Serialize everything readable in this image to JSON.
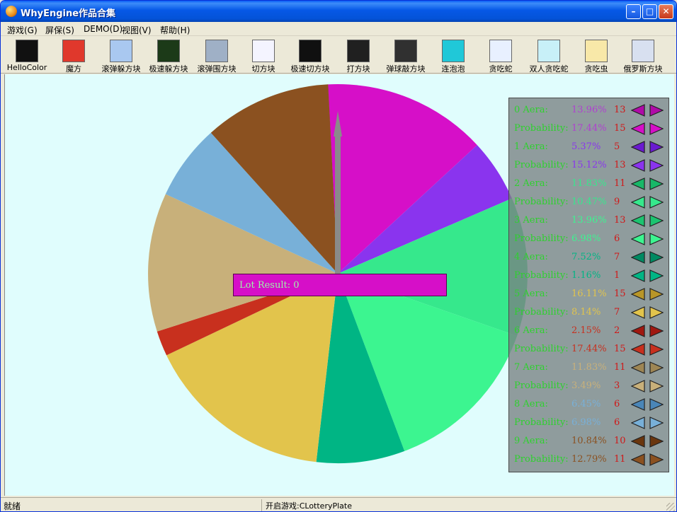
{
  "window": {
    "title": "WhyEngine作品合集",
    "minimize": "–",
    "maximize": "□",
    "close": "✕"
  },
  "menu": [
    "游戏(G)",
    "屏保(S)",
    "DEMO(D)",
    "视图(V)",
    "帮助(H)"
  ],
  "toolbar": [
    {
      "label": "HelloColor",
      "icon": "hello-color-icon",
      "color": "#111111"
    },
    {
      "label": "魔方",
      "icon": "rubik-cube-icon",
      "color": "#e0382c"
    },
    {
      "label": "滚弹躲方块",
      "icon": "ball-dodge-icon",
      "color": "#a9c8f0"
    },
    {
      "label": "极速躲方块",
      "icon": "speed-dodge-icon",
      "color": "#1c3a18"
    },
    {
      "label": "滚弹围方块",
      "icon": "ball-circle-icon",
      "color": "#9fb0c6"
    },
    {
      "label": "切方块",
      "icon": "cut-block-icon",
      "color": "#f4f4ff"
    },
    {
      "label": "极速切方块",
      "icon": "speed-cut-icon",
      "color": "#101010"
    },
    {
      "label": "打方块",
      "icon": "hit-block-icon",
      "color": "#202020"
    },
    {
      "label": "弹球敲方块",
      "icon": "pinball-block-icon",
      "color": "#303030"
    },
    {
      "label": "连泡泡",
      "icon": "bubble-link-icon",
      "color": "#20c8d8"
    },
    {
      "label": "贪吃蛇",
      "icon": "snake-icon",
      "color": "#e8f0ff"
    },
    {
      "label": "双人贪吃蛇",
      "icon": "two-player-snake-icon",
      "color": "#c8f0f8"
    },
    {
      "label": "贪吃虫",
      "icon": "worm-icon",
      "color": "#f8e8a8"
    },
    {
      "label": "俄罗斯方块",
      "icon": "tetris-icon",
      "color": "#d8e0f0"
    }
  ],
  "lot_result": "Lot Result: 0",
  "sectors": [
    {
      "index": 0,
      "aera_label": "0 Aera:",
      "aera": "13.96%",
      "aera_count": "13",
      "prob_label": "Probability:",
      "prob": "17.44%",
      "prob_count": "15",
      "color": "#d60fc8",
      "text_color": "#b040d0",
      "dark": "#b00aa8"
    },
    {
      "index": 1,
      "aera_label": "1 Aera:",
      "aera": "5.37%",
      "aera_count": "5",
      "prob_label": "Probability:",
      "prob": "15.12%",
      "prob_count": "13",
      "color": "#8a34ee",
      "text_color": "#8a34ee",
      "dark": "#6a1ad0"
    },
    {
      "index": 2,
      "aera_label": "2 Aera:",
      "aera": "11.83%",
      "aera_count": "11",
      "prob_label": "Probability:",
      "prob": "10.47%",
      "prob_count": "9",
      "color": "#36e88c",
      "text_color": "#36e88c",
      "dark": "#18b868"
    },
    {
      "index": 3,
      "aera_label": "3 Aera:",
      "aera": "13.96%",
      "aera_count": "13",
      "prob_label": "Probability:",
      "prob": "6.98%",
      "prob_count": "6",
      "color": "#3cf590",
      "text_color": "#3cf590",
      "dark": "#1cc470"
    },
    {
      "index": 4,
      "aera_label": "4 Aera:",
      "aera": "7.52%",
      "aera_count": "7",
      "prob_label": "Probability:",
      "prob": "1.16%",
      "prob_count": "1",
      "color": "#00b584",
      "text_color": "#00b584",
      "dark": "#008a62"
    },
    {
      "index": 5,
      "aera_label": "5 Aera:",
      "aera": "16.11%",
      "aera_count": "15",
      "prob_label": "Probability:",
      "prob": "8.14%",
      "prob_count": "7",
      "color": "#e2c44c",
      "text_color": "#e2c44c",
      "dark": "#b89628"
    },
    {
      "index": 6,
      "aera_label": "6 Aera:",
      "aera": "2.15%",
      "aera_count": "2",
      "prob_label": "Probability:",
      "prob": "17.44%",
      "prob_count": "15",
      "color": "#c8301e",
      "text_color": "#c8301e",
      "dark": "#a01810"
    },
    {
      "index": 7,
      "aera_label": "7 Aera:",
      "aera": "11.83%",
      "aera_count": "11",
      "prob_label": "Probability:",
      "prob": "3.49%",
      "prob_count": "3",
      "color": "#c8b07a",
      "text_color": "#c8b07a",
      "dark": "#9e8654"
    },
    {
      "index": 8,
      "aera_label": "8 Aera:",
      "aera": "6.45%",
      "aera_count": "6",
      "prob_label": "Probability:",
      "prob": "6.98%",
      "prob_count": "6",
      "color": "#78b0d8",
      "text_color": "#78b0d8",
      "dark": "#4a86b8"
    },
    {
      "index": 9,
      "aera_label": "9 Aera:",
      "aera": "10.84%",
      "aera_count": "10",
      "prob_label": "Probability:",
      "prob": "12.79%",
      "prob_count": "11",
      "color": "#8b5120",
      "text_color": "#8b5120",
      "dark": "#6a360e"
    }
  ],
  "label_color": "#2ed12e",
  "status": {
    "left": "就绪",
    "right": "开启游戏:CLotteryPlate"
  }
}
